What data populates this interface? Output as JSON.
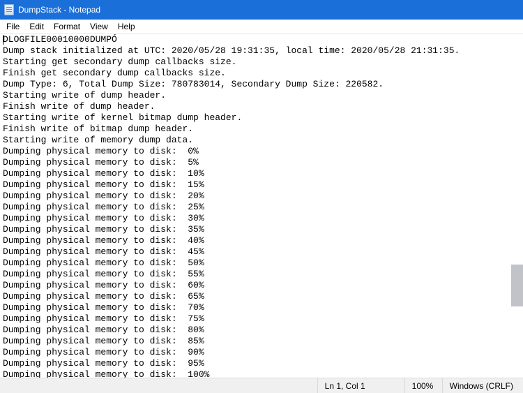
{
  "title": "DumpStack - Notepad",
  "menu": {
    "file": "File",
    "edit": "Edit",
    "format": "Format",
    "view": "View",
    "help": "Help"
  },
  "document": {
    "lines": [
      "DLOGFILE00010000DUMPÓ",
      "Dump stack initialized at UTC: 2020/05/28 19:31:35, local time: 2020/05/28 21:31:35.",
      "Starting get secondary dump callbacks size.",
      "Finish get secondary dump callbacks size.",
      "Dump Type: 6, Total Dump Size: 780783014, Secondary Dump Size: 220582.",
      "Starting write of dump header.",
      "Finish write of dump header.",
      "Starting write of kernel bitmap dump header.",
      "Finish write of bitmap dump header.",
      "Starting write of memory dump data.",
      "Dumping physical memory to disk:  0%",
      "Dumping physical memory to disk:  5%",
      "Dumping physical memory to disk:  10%",
      "Dumping physical memory to disk:  15%",
      "Dumping physical memory to disk:  20%",
      "Dumping physical memory to disk:  25%",
      "Dumping physical memory to disk:  30%",
      "Dumping physical memory to disk:  35%",
      "Dumping physical memory to disk:  40%",
      "Dumping physical memory to disk:  45%",
      "Dumping physical memory to disk:  50%",
      "Dumping physical memory to disk:  55%",
      "Dumping physical memory to disk:  60%",
      "Dumping physical memory to disk:  65%",
      "Dumping physical memory to disk:  70%",
      "Dumping physical memory to disk:  75%",
      "Dumping physical memory to disk:  80%",
      "Dumping physical memory to disk:  85%",
      "Dumping physical memory to disk:  90%",
      "Dumping physical memory to disk:  95%",
      "Dumping physical memory to disk:  100%"
    ]
  },
  "status": {
    "position": "Ln 1, Col 1",
    "zoom": "100%",
    "eol": "Windows (CRLF)"
  }
}
